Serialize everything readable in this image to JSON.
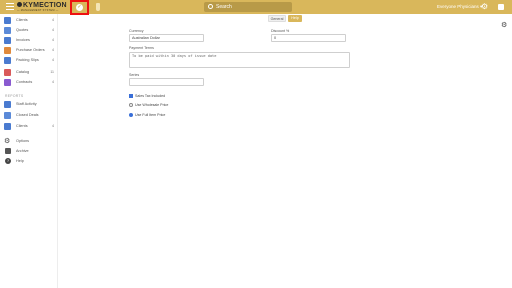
{
  "header": {
    "logo_text": "KYMECTION",
    "logo_tagline": "— MANAGEMENT SYSTEM —",
    "search_placeholder": "Search",
    "user_name": "Everyone Physicians"
  },
  "colors": {
    "brand": "#d9b75b",
    "highlight_box": "#ee1111",
    "checkbox_checked": "#3a6fd8"
  },
  "sidebar": {
    "items": [
      {
        "label": "Clients",
        "count": "4",
        "icon": "clients-icon",
        "color": "#4a7bd0"
      },
      {
        "label": "Quotes",
        "count": "4",
        "icon": "quotes-icon",
        "color": "#5b8ad8"
      },
      {
        "label": "Invoices",
        "count": "4",
        "icon": "invoices-icon",
        "color": "#4a7bd0"
      },
      {
        "label": "Purchase Orders",
        "count": "4",
        "icon": "purchase-orders-icon",
        "color": "#e08a3c"
      },
      {
        "label": "Packing Slips",
        "count": "4",
        "icon": "packing-slips-icon",
        "color": "#4a7bd0"
      },
      {
        "label": "Catalog",
        "count": "11",
        "icon": "catalog-icon",
        "color": "#d95a5a"
      },
      {
        "label": "Contracts",
        "count": "4",
        "icon": "contracts-icon",
        "color": "#8a5ad0"
      }
    ],
    "reports_label": "REPORTS",
    "report_items": [
      {
        "label": "Staff Activity",
        "icon": "staff-activity-icon",
        "color": "#4a7bd0"
      },
      {
        "label": "Closed Deals",
        "icon": "closed-deals-icon",
        "color": "#5b8ad8"
      },
      {
        "label": "Clients",
        "count": "4",
        "icon": "clients-report-icon",
        "color": "#4a7bd0"
      }
    ],
    "bottom_items": [
      {
        "label": "Options",
        "icon": "gear-icon"
      },
      {
        "label": "Archive",
        "icon": "archive-icon"
      },
      {
        "label": "Help",
        "icon": "help-icon"
      }
    ]
  },
  "tabs": {
    "general": "General",
    "help": "Help"
  },
  "form": {
    "currency_label": "Currency",
    "currency_value": "Australian Dollar",
    "discount_label": "Discount %",
    "discount_value": "0",
    "payment_terms_label": "Payment Terms",
    "payment_terms_value": "To be paid within 30 days of issue date",
    "series_label": "Series",
    "series_value": "",
    "options": [
      {
        "label": "Sales Tax Included",
        "checked": true,
        "kind": "checkbox"
      },
      {
        "label": "Use Wholesale Price",
        "checked": false,
        "kind": "radio"
      },
      {
        "label": "Use Full Item Price",
        "checked": true,
        "kind": "radio"
      }
    ]
  }
}
